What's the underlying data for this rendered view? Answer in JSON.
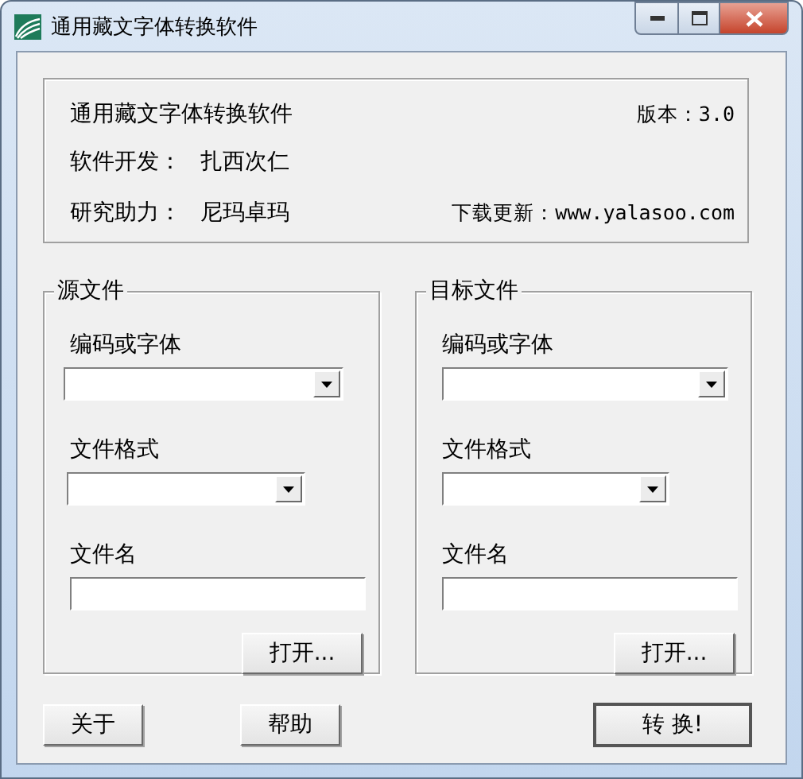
{
  "window": {
    "title": "通用藏文字体转换软件"
  },
  "info": {
    "app_name": "通用藏文字体转换软件",
    "version": "版本：3.0",
    "developer_label": "软件开发：",
    "developer": "扎西次仁",
    "assistant_label": "研究助力：",
    "assistant": "尼玛卓玛",
    "download": "下载更新：www.yalasoo.com"
  },
  "groups": [
    {
      "title": "源文件",
      "fields": [
        {
          "kind": "dropdown",
          "label": "编码或字体"
        },
        {
          "kind": "dropdown",
          "label": "文件格式"
        },
        {
          "kind": "text",
          "label": "文件名"
        }
      ],
      "open_button": "打开..."
    },
    {
      "title": "目标文件",
      "fields": [
        {
          "kind": "dropdown",
          "label": "编码或字体"
        },
        {
          "kind": "dropdown",
          "label": "文件格式"
        },
        {
          "kind": "text",
          "label": "文件名"
        }
      ],
      "open_button": "打开..."
    }
  ],
  "buttons": [
    {
      "label": "关于",
      "default": false
    },
    {
      "label": "帮助",
      "default": false
    },
    {
      "label": "转 换!",
      "default": true
    }
  ]
}
